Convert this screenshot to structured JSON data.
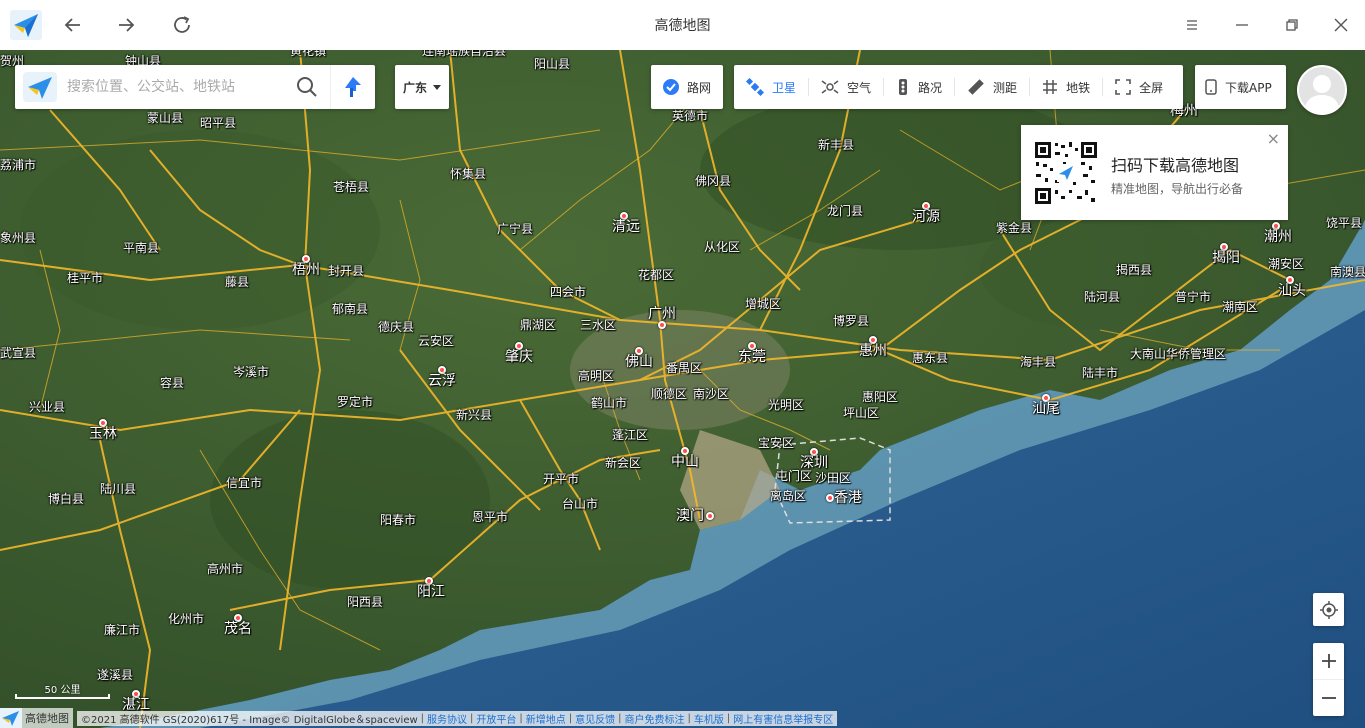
{
  "titlebar": {
    "title": "高德地图",
    "back_icon": "arrow-left-icon",
    "forward_icon": "arrow-right-icon",
    "refresh_icon": "refresh-icon"
  },
  "search": {
    "placeholder": "搜索位置、公交站、地铁站"
  },
  "city_selector": {
    "label": "广东"
  },
  "road_toggle": {
    "label": "路网",
    "checked": true
  },
  "tools": {
    "satellite": "卫星",
    "air": "空气",
    "traffic": "路况",
    "ranging": "测距",
    "subway": "地铁",
    "fullscreen": "全屏"
  },
  "download_app": "下载APP",
  "qr_card": {
    "title": "扫码下载高德地图",
    "subtitle": "精准地图，导航出行必备",
    "close": "×"
  },
  "scale_label": "50 公里",
  "footer": {
    "brand": "高德地图",
    "copyright": "©2021 高德软件 GS(2020)617号 - Image© DigitalGlobe＆spaceview",
    "links": [
      "服务协议",
      "开放平台",
      "新增地点",
      "意见反馈",
      "商户免费标注",
      "车机版",
      "网上有害信息举报专区"
    ]
  },
  "places": [
    {
      "name": "黄花镇",
      "dot": false
    },
    {
      "name": "阳山县",
      "dot": false
    },
    {
      "name": "英德市",
      "dot": false
    },
    {
      "name": "佛冈县",
      "dot": false
    },
    {
      "name": "新丰县",
      "dot": false
    },
    {
      "name": "龙门县",
      "dot": false
    },
    {
      "name": "河源",
      "dot": true
    },
    {
      "name": "紫金县",
      "dot": false
    },
    {
      "name": "梅州",
      "dot": true
    },
    {
      "name": "饶平县",
      "dot": false
    },
    {
      "name": "潮州",
      "dot": true
    },
    {
      "name": "揭阳",
      "dot": true
    },
    {
      "name": "潮安区",
      "dot": false
    },
    {
      "name": "揭西县",
      "dot": false
    },
    {
      "name": "陆河县",
      "dot": false
    },
    {
      "name": "普宁市",
      "dot": false
    },
    {
      "name": "潮南区",
      "dot": false
    },
    {
      "name": "汕头",
      "dot": true
    },
    {
      "name": "南澳县",
      "dot": false
    },
    {
      "name": "大南山华侨管理区",
      "dot": false
    },
    {
      "name": "海丰县",
      "dot": false
    },
    {
      "name": "陆丰市",
      "dot": false
    },
    {
      "name": "汕尾",
      "dot": true
    },
    {
      "name": "惠东县",
      "dot": false
    },
    {
      "name": "惠州",
      "dot": true
    },
    {
      "name": "博罗县",
      "dot": false
    },
    {
      "name": "惠阳区",
      "dot": false
    },
    {
      "name": "坪山区",
      "dot": false
    },
    {
      "name": "清远",
      "dot": true
    },
    {
      "name": "从化区",
      "dot": false
    },
    {
      "name": "花都区",
      "dot": false
    },
    {
      "name": "增城区",
      "dot": false
    },
    {
      "name": "广州",
      "dot": true
    },
    {
      "name": "东莞",
      "dot": true
    },
    {
      "name": "光明区",
      "dot": false
    },
    {
      "name": "宝安区",
      "dot": false
    },
    {
      "name": "深圳",
      "dot": true
    },
    {
      "name": "沙田区",
      "dot": false
    },
    {
      "name": "屯门区",
      "dot": false
    },
    {
      "name": "香港",
      "dot": true
    },
    {
      "name": "离岛区",
      "dot": false
    },
    {
      "name": "澳门",
      "dot": true
    },
    {
      "name": "中山",
      "dot": true
    },
    {
      "name": "南沙区",
      "dot": false
    },
    {
      "name": "番禺区",
      "dot": false
    },
    {
      "name": "顺德区",
      "dot": false
    },
    {
      "name": "佛山",
      "dot": true
    },
    {
      "name": "三水区",
      "dot": false
    },
    {
      "name": "四会市",
      "dot": false
    },
    {
      "name": "鼎湖区",
      "dot": false
    },
    {
      "name": "肇庆",
      "dot": true
    },
    {
      "name": "高明区",
      "dot": false
    },
    {
      "name": "鹤山市",
      "dot": false
    },
    {
      "name": "蓬江区",
      "dot": false
    },
    {
      "name": "新会区",
      "dot": false
    },
    {
      "name": "开平市",
      "dot": false
    },
    {
      "name": "台山市",
      "dot": false
    },
    {
      "name": "恩平市",
      "dot": false
    },
    {
      "name": "阳春市",
      "dot": false
    },
    {
      "name": "阳江",
      "dot": true
    },
    {
      "name": "阳西县",
      "dot": false
    },
    {
      "name": "新兴县",
      "dot": false
    },
    {
      "name": "云浮",
      "dot": true
    },
    {
      "name": "云安区",
      "dot": false
    },
    {
      "name": "罗定市",
      "dot": false
    },
    {
      "name": "德庆县",
      "dot": false
    },
    {
      "name": "广宁县",
      "dot": false
    },
    {
      "name": "怀集县",
      "dot": false
    },
    {
      "name": "封开县",
      "dot": false
    },
    {
      "name": "郁南县",
      "dot": false
    },
    {
      "name": "苍梧县",
      "dot": false
    },
    {
      "name": "梧州",
      "dot": true
    },
    {
      "name": "藤县",
      "dot": false
    },
    {
      "name": "岑溪市",
      "dot": false
    },
    {
      "name": "容县",
      "dot": false
    },
    {
      "name": "平南县",
      "dot": false
    },
    {
      "name": "桂平市",
      "dot": false
    },
    {
      "name": "兴业县",
      "dot": false
    },
    {
      "name": "玉林",
      "dot": true
    },
    {
      "name": "陆川县",
      "dot": false
    },
    {
      "name": "博白县",
      "dot": false
    },
    {
      "name": "信宜市",
      "dot": false
    },
    {
      "name": "高州市",
      "dot": false
    },
    {
      "name": "化州市",
      "dot": false
    },
    {
      "name": "茂名",
      "dot": true
    },
    {
      "name": "廉江市",
      "dot": false
    },
    {
      "name": "遂溪县",
      "dot": false
    },
    {
      "name": "湛江",
      "dot": true
    },
    {
      "name": "钟山县",
      "dot": false
    },
    {
      "name": "昭平县",
      "dot": false
    },
    {
      "name": "蒙山县",
      "dot": false
    },
    {
      "name": "荔浦市",
      "dot": false
    },
    {
      "name": "象州县",
      "dot": false
    },
    {
      "name": "武宣县",
      "dot": false
    },
    {
      "name": "连南瑶族自治县",
      "dot": false
    },
    {
      "name": "贺州",
      "dot": false
    }
  ]
}
